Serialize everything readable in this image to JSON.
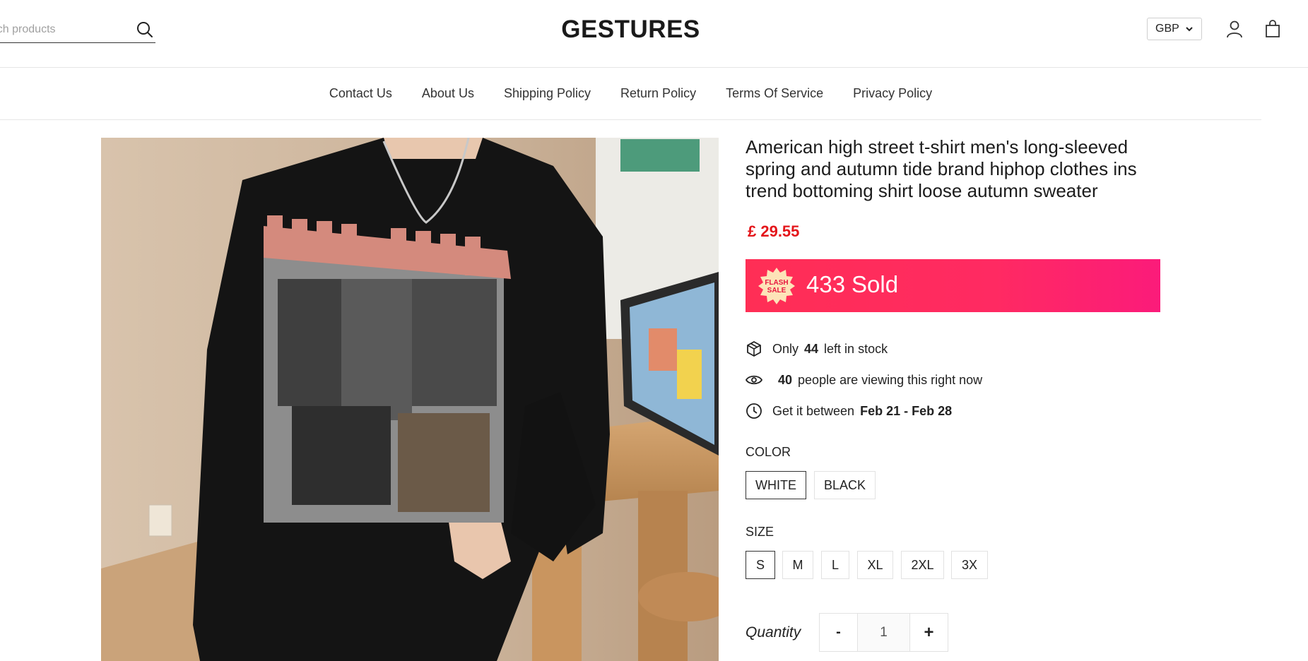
{
  "header": {
    "search_placeholder": "Search products",
    "logo": "GESTURES",
    "currency": "GBP"
  },
  "nav": {
    "items": [
      "Contact Us",
      "About Us",
      "Shipping Policy",
      "Return Policy",
      "Terms Of Service",
      "Privacy Policy"
    ]
  },
  "product": {
    "title": "American high street t-shirt men's long-sleeved spring and autumn tide brand hiphop clothes ins trend bottoming shirt loose autumn sweater",
    "price": "£ 29.55",
    "flash": {
      "badge_line1": "FLASH",
      "badge_line2": "SALE",
      "sold_count": "433",
      "sold_label": "Sold"
    },
    "stock": {
      "prefix": "Only",
      "count": "44",
      "suffix": "left in stock"
    },
    "viewers": {
      "count": "40",
      "suffix": "people are viewing this right now"
    },
    "delivery": {
      "prefix": "Get it between",
      "range": "Feb 21 - Feb 28"
    },
    "color": {
      "label": "COLOR",
      "options": [
        "WHITE",
        "BLACK"
      ],
      "selected": "WHITE"
    },
    "size": {
      "label": "SIZE",
      "options": [
        "S",
        "M",
        "L",
        "XL",
        "2XL",
        "3X"
      ],
      "selected": "S"
    },
    "quantity": {
      "label": "Quantity",
      "minus": "-",
      "value": "1",
      "plus": "+"
    }
  },
  "colors": {
    "price": "#e4161b",
    "flash_start": "#ff2e55",
    "flash_end": "#fb1b7a"
  }
}
